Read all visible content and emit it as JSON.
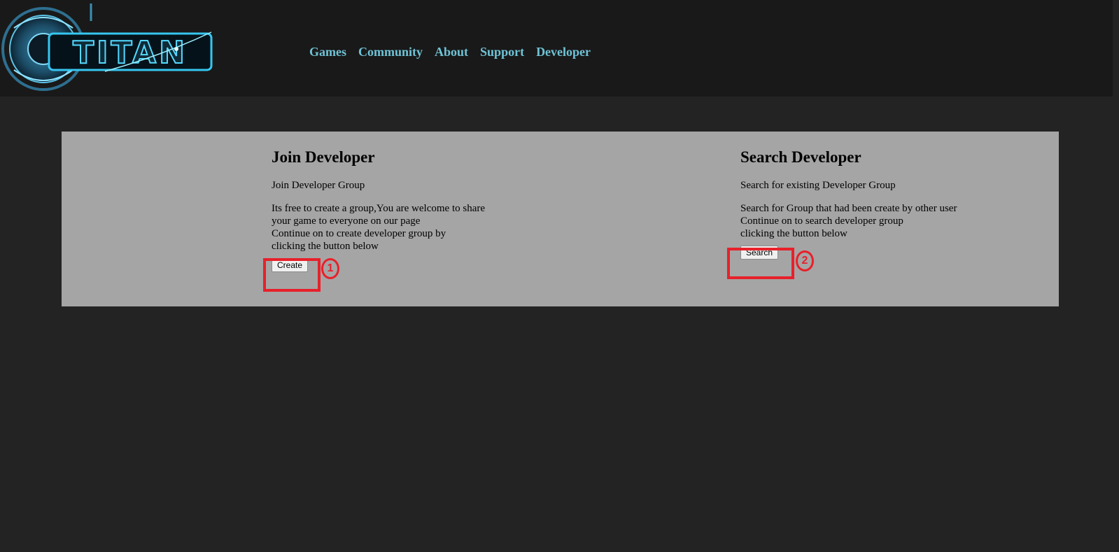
{
  "header": {
    "logo_alt": "TITAN",
    "nav": [
      "Games",
      "Community",
      "About",
      "Support",
      "Developer"
    ]
  },
  "join": {
    "title": "Join Developer",
    "subtitle": "Join Developer Group",
    "desc_lines": [
      "Its free to create a group,You are welcome to share",
      "your game to everyone on our page",
      "Continue on to create developer group by",
      "clicking the button below"
    ],
    "button_label": "Create"
  },
  "search": {
    "title": "Search Developer",
    "subtitle": "Search for existing Developer Group",
    "desc_lines": [
      "Search for Group that had been create by other user",
      "Continue on to search developer group",
      "clicking the button below"
    ],
    "button_label": "Search"
  },
  "annotations": [
    "1",
    "2"
  ],
  "colors": {
    "header_bg": "#191919",
    "page_bg": "#232323",
    "panel_bg": "#a5a5a5",
    "nav_link": "#6fc3d6",
    "annotation": "#e8202a"
  }
}
